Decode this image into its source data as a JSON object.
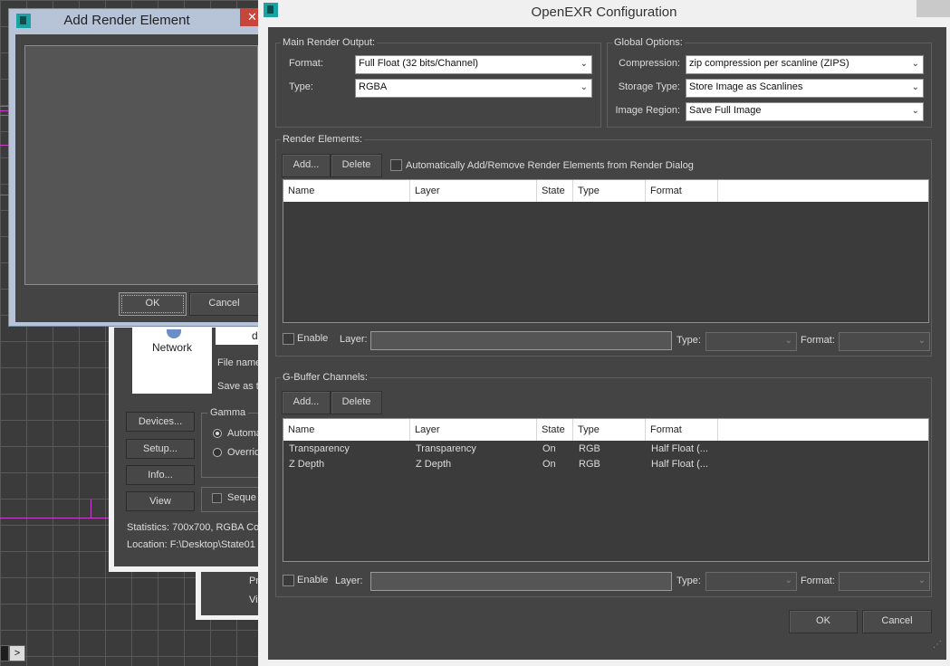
{
  "add_dialog": {
    "title": "Add Render Element",
    "ok_label": "OK",
    "cancel_label": "Cancel",
    "close_glyph": "✕"
  },
  "behind_window": {
    "network_label": "Network",
    "field_top_value": "d",
    "file_name_label": "File name",
    "save_as_label": "Save as t",
    "gamma_label": "Gamma",
    "gamma_auto": "Automa",
    "gamma_override": "Overrid",
    "devices_label": "Devices...",
    "setup_label": "Setup...",
    "info_label": "Info...",
    "view_label": "View",
    "sequence_label": "Seque",
    "statistics_text": "Statistics:  700x700, RGBA Col",
    "location_text": "Location:   F:\\Desktop\\State01",
    "lower_pr": "Pr",
    "lower_vie": "Vie"
  },
  "viewport": {
    "nav_arrow": ">"
  },
  "exr": {
    "title": "OpenEXR Configuration",
    "main_output": {
      "group_title": "Main Render Output:",
      "format_label": "Format:",
      "format_value": "Full Float (32 bits/Channel)",
      "type_label": "Type:",
      "type_value": "RGBA"
    },
    "global_options": {
      "group_title": "Global Options:",
      "compression_label": "Compression:",
      "compression_value": "zip compression per scanline (ZIPS)",
      "storage_label": "Storage Type:",
      "storage_value": "Store Image as Scanlines",
      "region_label": "Image Region:",
      "region_value": "Save Full Image"
    },
    "render_elements": {
      "group_title": "Render Elements:",
      "add_label": "Add...",
      "delete_label": "Delete",
      "auto_label": "Automatically Add/Remove Render Elements from Render Dialog",
      "columns": [
        "Name",
        "Layer",
        "State",
        "Type",
        "Format"
      ],
      "rows": [],
      "enable_label": "Enable",
      "layer_label": "Layer:",
      "type_label": "Type:",
      "format_label": "Format:"
    },
    "gbuffer": {
      "group_title": "G-Buffer Channels:",
      "add_label": "Add...",
      "delete_label": "Delete",
      "columns": [
        "Name",
        "Layer",
        "State",
        "Type",
        "Format"
      ],
      "rows": [
        {
          "name": "Transparency",
          "layer": "Transparency",
          "state": "On",
          "type": "RGB",
          "format": "Half Float (..."
        },
        {
          "name": "Z Depth",
          "layer": "Z Depth",
          "state": "On",
          "type": "RGB",
          "format": "Half Float (..."
        }
      ],
      "enable_label": "Enable",
      "layer_label": "Layer:",
      "type_label": "Type:",
      "format_label": "Format:"
    },
    "ok_label": "OK",
    "cancel_label": "Cancel",
    "dropdown_glyph": "⌄",
    "grip_glyph": "⋰"
  },
  "colors": {
    "panel_bg": "#444444",
    "dialog_frame": "#b7c3d7",
    "close_red": "#c7463c",
    "viewport_guide_magenta": "#c640c6"
  },
  "icons": {
    "app_logo": "app-logo-icon",
    "close": "close-icon",
    "dropdown": "chevron-down-icon",
    "resize": "resize-grip-icon",
    "network": "network-icon"
  }
}
